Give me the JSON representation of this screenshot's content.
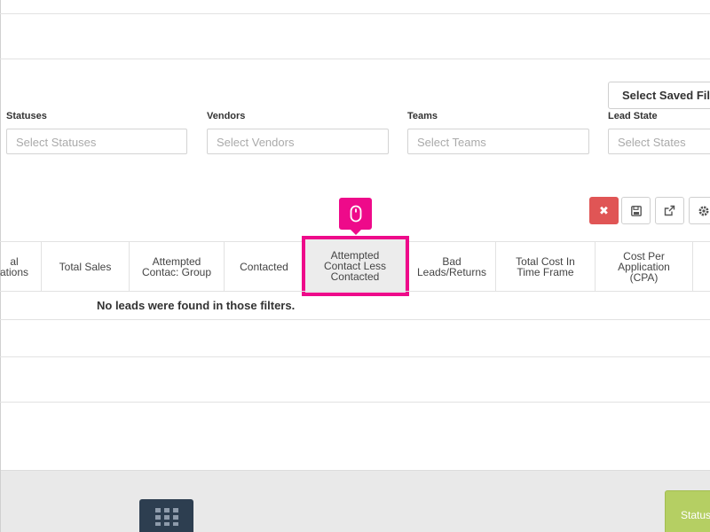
{
  "toolbar": {
    "saved_filter_label": "Select Saved Filt",
    "clear_symbol": "✖"
  },
  "filters": {
    "statuses": {
      "label": "Statuses",
      "placeholder": "Select Statuses"
    },
    "vendors": {
      "label": "Vendors",
      "placeholder": "Select Vendors"
    },
    "teams": {
      "label": "Teams",
      "placeholder": "Select Teams"
    },
    "lead_state": {
      "label": "Lead State",
      "placeholder": "Select States"
    }
  },
  "table": {
    "columns": [
      {
        "line1": "al",
        "line2": "ations"
      },
      {
        "line1": "Total Sales"
      },
      {
        "line1": "Attempted",
        "line2": "Contac: Group"
      },
      {
        "line1": "Contacted"
      },
      {
        "line1": "Attempted",
        "line2": "Contact Less",
        "line3": "Contacted"
      },
      {
        "line1": "Bad",
        "line2": "Leads/Returns"
      },
      {
        "line1": "Total Cost In",
        "line2": "Time Frame"
      },
      {
        "line1": "Cost Per",
        "line2": "Application",
        "line3": "(CPA)"
      }
    ],
    "empty_message": "No leads were found in those filters."
  },
  "footer": {
    "status_tab_label": "Status"
  },
  "colors": {
    "accent_highlight": "#ee0a8a",
    "clear_button": "#e05555",
    "grid_button": "#2d3e50",
    "status_tab": "#b5cf63"
  },
  "icons": {
    "clear": "close-icon",
    "save": "save-icon",
    "export": "external-link-icon",
    "settings": "gear-icon",
    "mouse": "mouse-icon",
    "grid": "grid-icon"
  }
}
